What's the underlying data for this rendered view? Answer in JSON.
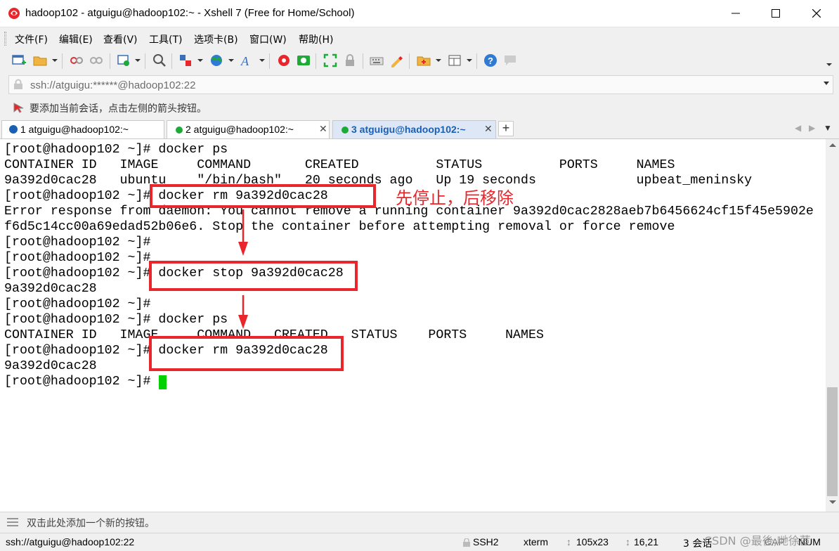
{
  "window": {
    "title": "hadoop102 - atguigu@hadoop102:~ - Xshell 7 (Free for Home/School)"
  },
  "menu": [
    "文件(F)",
    "编辑(E)",
    "查看(V)",
    "工具(T)",
    "选项卡(B)",
    "窗口(W)",
    "帮助(H)"
  ],
  "address": {
    "value": "ssh://atguigu:******@hadoop102:22"
  },
  "hint": "要添加当前会话，点击左侧的箭头按钮。",
  "tabs": [
    {
      "label": "1 atguigu@hadoop102:~",
      "status_color": "#1a5fb4"
    },
    {
      "label": "2 atguigu@hadoop102:~",
      "status_color": "#1eaa39"
    },
    {
      "label": "3 atguigu@hadoop102:~",
      "status_color": "#1eaa39"
    }
  ],
  "terminal": {
    "lines": [
      "[root@hadoop102 ~]# docker ps",
      "CONTAINER ID   IMAGE     COMMAND       CREATED          STATUS          PORTS     NAMES",
      "9a392d0cac28   ubuntu    \"/bin/bash\"   20 seconds ago   Up 19 seconds             upbeat_meninsky",
      "[root@hadoop102 ~]# docker rm 9a392d0cac28",
      "Error response from daemon: You cannot remove a running container 9a392d0cac2828aeb7b6456624cf15f45e5902e",
      "f6d5c14cc00a69edad52b06e6. Stop the container before attempting removal or force remove",
      "[root@hadoop102 ~]#",
      "[root@hadoop102 ~]#",
      "[root@hadoop102 ~]# docker stop 9a392d0cac28",
      "9a392d0cac28",
      "[root@hadoop102 ~]#",
      "[root@hadoop102 ~]# docker ps",
      "CONTAINER ID   IMAGE     COMMAND   CREATED   STATUS    PORTS     NAMES",
      "[root@hadoop102 ~]# docker rm 9a392d0cac28",
      "9a392d0cac28",
      "[root@hadoop102 ~]# "
    ],
    "annotation": "先停止，后移除"
  },
  "quickbar": "双击此处添加一个新的按钮。",
  "status": {
    "connection": "ssh://atguigu@hadoop102:22",
    "protocol": "SSH2",
    "term": "xterm",
    "size": "105x23",
    "cursor": "16,21",
    "sessions": "3 会话",
    "caps": "CAP",
    "num": "NUM"
  },
  "watermark": "CSDN @最後,哋徐茝",
  "colors": {
    "annotation": "#e8262b",
    "cursor": "#00d100",
    "active_tab": "#1a5fb4"
  }
}
